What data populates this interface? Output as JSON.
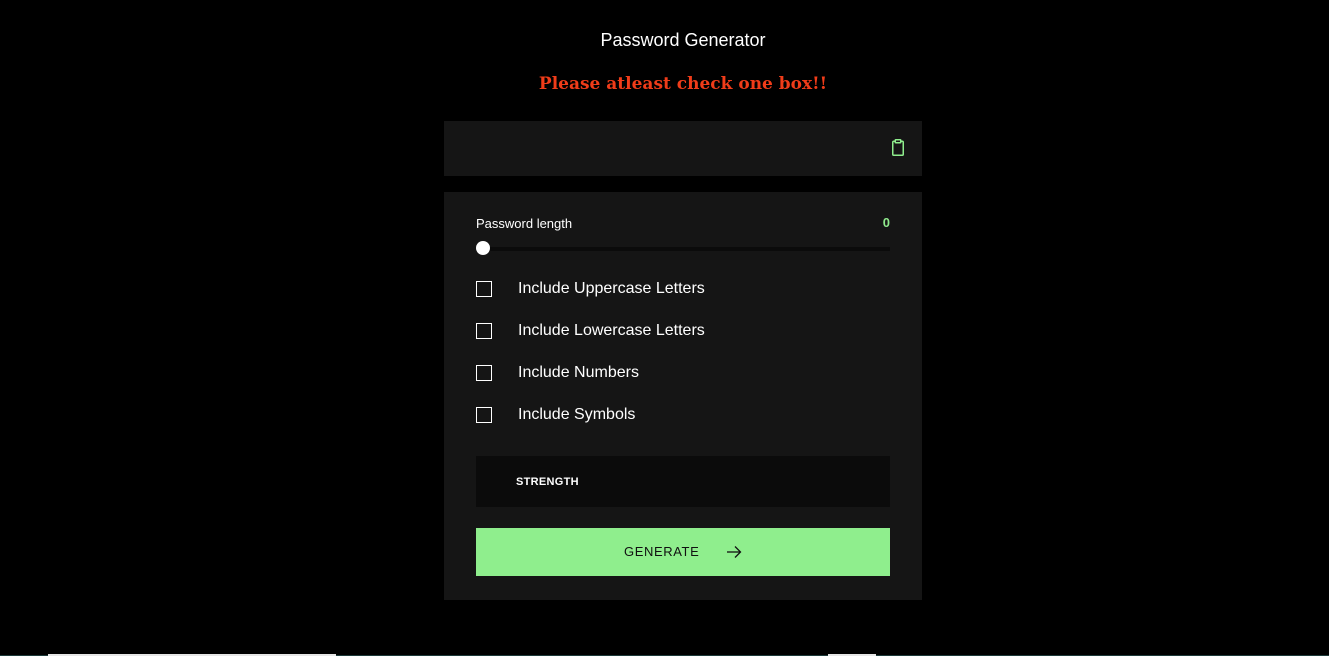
{
  "app": {
    "title": "Password Generator",
    "error_message": "Please atleast check one box!!"
  },
  "output": {
    "password": "",
    "copy_icon": "clipboard-icon"
  },
  "length": {
    "label": "Password length",
    "value": "0",
    "slider_fraction": 0
  },
  "options": [
    {
      "label": "Include Uppercase Letters",
      "checked": false
    },
    {
      "label": "Include Lowercase Letters",
      "checked": false
    },
    {
      "label": "Include Numbers",
      "checked": false
    },
    {
      "label": "Include Symbols",
      "checked": false
    }
  ],
  "strength": {
    "label": "STRENGTH"
  },
  "generate": {
    "label": "GENERATE",
    "icon": "arrow-right-icon"
  },
  "colors": {
    "accent": "#8fee8d",
    "error": "#f03c19",
    "background": "#000000",
    "panel": "#151515"
  }
}
